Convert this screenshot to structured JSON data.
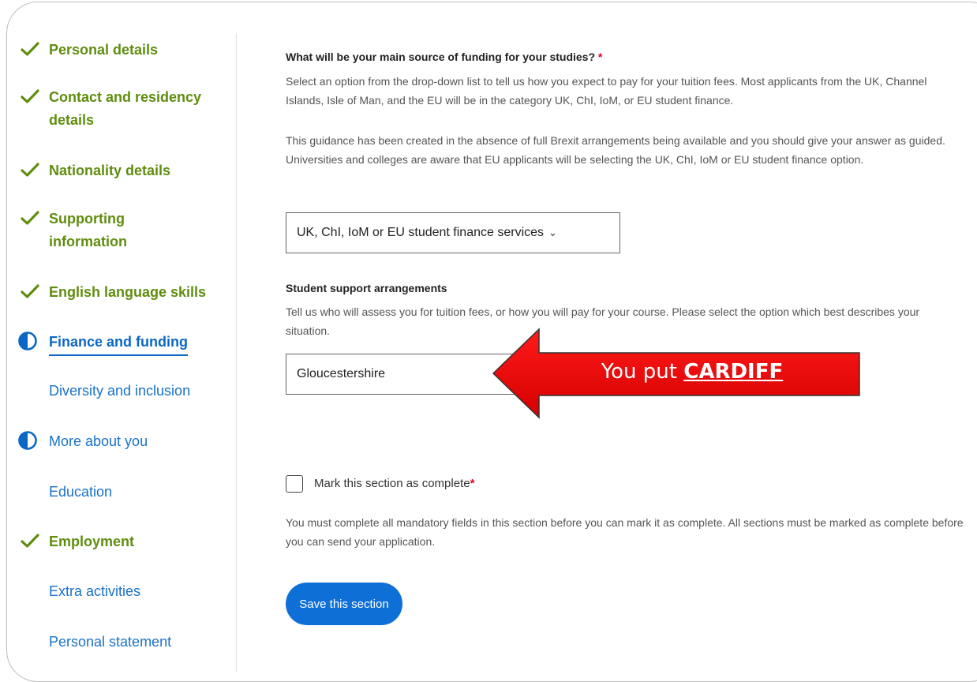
{
  "sidebar": {
    "items": [
      {
        "label": "Personal details",
        "status": "done",
        "icon": "check-icon"
      },
      {
        "label": "Contact and residency details",
        "status": "done",
        "icon": "check-icon"
      },
      {
        "label": "Nationality details",
        "status": "done",
        "icon": "check-icon"
      },
      {
        "label": "Supporting information",
        "status": "done",
        "icon": "check-icon"
      },
      {
        "label": "English language skills",
        "status": "done",
        "icon": "check-icon"
      },
      {
        "label": "Finance and funding",
        "status": "in-progress",
        "icon": "half-circle-icon"
      },
      {
        "label": "Diversity and inclusion",
        "status": "todo",
        "icon": ""
      },
      {
        "label": "More about you",
        "status": "in-progress",
        "icon": "half-circle-icon"
      },
      {
        "label": "Education",
        "status": "todo",
        "icon": ""
      },
      {
        "label": "Employment",
        "status": "done",
        "icon": "check-icon"
      },
      {
        "label": "Extra activities",
        "status": "todo",
        "icon": ""
      },
      {
        "label": "Personal statement",
        "status": "todo",
        "icon": ""
      }
    ]
  },
  "funding": {
    "question": "What will be your main source of funding for your studies?",
    "required_mark": "*",
    "help1": "Select an option from the drop-down list to tell us how you expect to pay for your tuition fees. Most applicants from the UK, Channel Islands, Isle of Man, and the EU will be in the category UK, ChI, IoM, or EU student finance.",
    "help2": "This guidance has been created in the absence of full Brexit arrangements being available and you should give your answer as guided. Universities and colleges are aware that EU applicants will be selecting the UK, ChI, IoM or EU student finance option.",
    "selected": "UK, ChI, IoM or EU student finance services",
    "chevron": "⌄"
  },
  "support": {
    "label": "Student support arrangements",
    "help": "Tell us who will assess you for tuition fees, or how you will pay for your course. Please select the option which best describes your situation.",
    "selected": "Gloucestershire"
  },
  "complete": {
    "label": "Mark this section as complete",
    "required_mark": "*",
    "help": "You must complete all mandatory fields in this section before you can mark it as complete. All sections must be marked as complete before you can send your application."
  },
  "save_label": "Save this section",
  "annotation": {
    "prefix": "You put ",
    "highlight": "CARDIFF",
    "color": "#e10600"
  },
  "colors": {
    "done": "#5f8d0e",
    "current": "#0b67c6",
    "todo": "#1a72c9",
    "button": "#0e6fd6",
    "required": "#e2001a"
  }
}
